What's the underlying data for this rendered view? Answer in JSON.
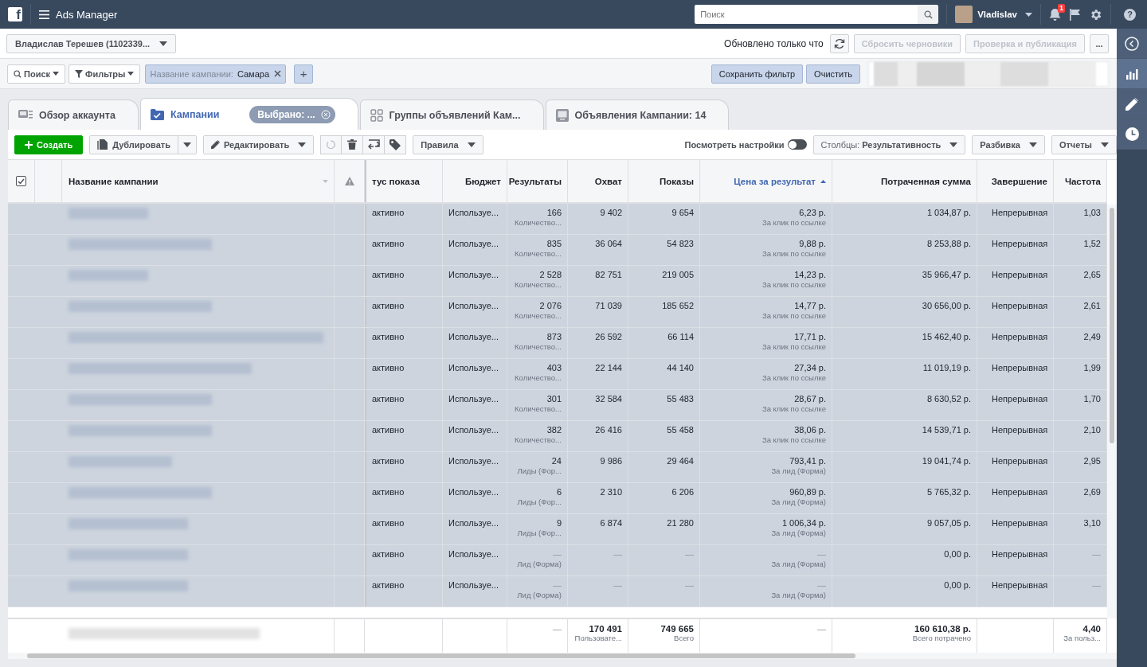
{
  "topbar": {
    "logo": "f",
    "app_title": "Ads Manager",
    "search_placeholder": "Поиск",
    "user": "Vladislav",
    "notification_count": "1",
    "help": "?"
  },
  "account_bar": {
    "account": "Владислав Терешев (1102339...",
    "updated": "Обновлено только что",
    "buttons": [
      {
        "label": "Сбросить черновики",
        "disabled": true
      },
      {
        "label": "Проверка и публикация",
        "disabled": true
      }
    ],
    "more": "..."
  },
  "filter_bar": {
    "search": "Поиск",
    "filters": "Фильтры",
    "chip": {
      "label": "Название кампании:",
      "value": "Самара"
    },
    "add": "+",
    "save_filter": "Сохранить фильтр",
    "clear": "Очистить"
  },
  "tabs": [
    {
      "kind": "overview",
      "label": "Обзор аккаунта",
      "selected": false
    },
    {
      "kind": "campaigns",
      "label": "Кампании",
      "selected": true,
      "badge": "Выбрано: ..."
    },
    {
      "kind": "adsets",
      "label": "Группы объявлений Кам...",
      "selected": false
    },
    {
      "kind": "ads",
      "label": "Объявления Кампании: 14",
      "selected": false
    }
  ],
  "toolbar": {
    "create": "Создать",
    "duplicate": "Дублировать",
    "edit": "Редактировать",
    "rules": "Правила",
    "view_settings": {
      "label": "Посмотреть настройки",
      "on": false
    },
    "columns": {
      "label": "Столбцы:",
      "value": "Результативность"
    },
    "breakdown": "Разбивка",
    "reports": "Отчеты"
  },
  "table": {
    "all_checked": true,
    "columns": [
      {
        "label": "Название кампании",
        "sorted": false
      },
      {
        "label": "тус показа",
        "sorted": false
      },
      {
        "label": "Бюджет",
        "sorted": false
      },
      {
        "label": "Результаты",
        "sorted": false
      },
      {
        "label": "Охват",
        "sorted": false
      },
      {
        "label": "Показы",
        "sorted": false
      },
      {
        "label": "Цена за результат",
        "sorted": true
      },
      {
        "label": "Потраченная сумма",
        "sorted": false
      },
      {
        "label": "Завершение",
        "sorted": false
      },
      {
        "label": "Частота",
        "sorted": false
      }
    ],
    "rows": [
      {
        "selected": true,
        "status": "активно",
        "budget": "Используе...",
        "results": "166",
        "results_sub": "Количество...",
        "reach": "9 402",
        "impressions": "9 654",
        "cost": "6,23 р.",
        "cost_sub": "За клик по ссылке",
        "spent": "1 034,87 р.",
        "end": "Непрерывная",
        "frequency": "1,03"
      },
      {
        "selected": true,
        "status": "активно",
        "budget": "Используе...",
        "results": "835",
        "results_sub": "Количество...",
        "reach": "36 064",
        "impressions": "54 823",
        "cost": "9,88 р.",
        "cost_sub": "За клик по ссылке",
        "spent": "8 253,88 р.",
        "end": "Непрерывная",
        "frequency": "1,52"
      },
      {
        "selected": true,
        "status": "активно",
        "budget": "Используе...",
        "results": "2 528",
        "results_sub": "Количество...",
        "reach": "82 751",
        "impressions": "219 005",
        "cost": "14,23 р.",
        "cost_sub": "За клик по ссылке",
        "spent": "35 966,47 р.",
        "end": "Непрерывная",
        "frequency": "2,65"
      },
      {
        "selected": true,
        "status": "активно",
        "budget": "Используе...",
        "results": "2 076",
        "results_sub": "Количество...",
        "reach": "71 039",
        "impressions": "185 652",
        "cost": "14,77 р.",
        "cost_sub": "За клик по ссылке",
        "spent": "30 656,00 р.",
        "end": "Непрерывная",
        "frequency": "2,61"
      },
      {
        "selected": true,
        "status": "активно",
        "budget": "Используе...",
        "results": "873",
        "results_sub": "Количество...",
        "reach": "26 592",
        "impressions": "66 114",
        "cost": "17,71 р.",
        "cost_sub": "За клик по ссылке",
        "spent": "15 462,40 р.",
        "end": "Непрерывная",
        "frequency": "2,49"
      },
      {
        "selected": true,
        "status": "активно",
        "budget": "Используе...",
        "results": "403",
        "results_sub": "Количество...",
        "reach": "22 144",
        "impressions": "44 140",
        "cost": "27,34 р.",
        "cost_sub": "За клик по ссылке",
        "spent": "11 019,19 р.",
        "end": "Непрерывная",
        "frequency": "1,99"
      },
      {
        "selected": true,
        "status": "активно",
        "budget": "Используе...",
        "results": "301",
        "results_sub": "Количество...",
        "reach": "32 584",
        "impressions": "55 483",
        "cost": "28,67 р.",
        "cost_sub": "За клик по ссылке",
        "spent": "8 630,52 р.",
        "end": "Непрерывная",
        "frequency": "1,70"
      },
      {
        "selected": true,
        "status": "активно",
        "budget": "Используе...",
        "results": "382",
        "results_sub": "Количество...",
        "reach": "26 416",
        "impressions": "55 458",
        "cost": "38,06 р.",
        "cost_sub": "За клик по ссылке",
        "spent": "14 539,71 р.",
        "end": "Непрерывная",
        "frequency": "2,10"
      },
      {
        "selected": true,
        "status": "активно",
        "budget": "Используе...",
        "results": "24",
        "results_sub": "Лиды (Фор...",
        "reach": "9 986",
        "impressions": "29 464",
        "cost": "793,41 р.",
        "cost_sub": "За лид (Форма)",
        "spent": "19 041,74 р.",
        "end": "Непрерывная",
        "frequency": "2,95"
      },
      {
        "selected": true,
        "status": "активно",
        "budget": "Используе...",
        "results": "6",
        "results_sub": "Лиды (Фор...",
        "reach": "2 310",
        "impressions": "6 206",
        "cost": "960,89 р.",
        "cost_sub": "За лид (Форма)",
        "spent": "5 765,32 р.",
        "end": "Непрерывная",
        "frequency": "2,69"
      },
      {
        "selected": true,
        "status": "активно",
        "budget": "Используе...",
        "results": "9",
        "results_sub": "Лиды (Фор...",
        "reach": "6 874",
        "impressions": "21 280",
        "cost": "1 006,34 р.",
        "cost_sub": "За лид (Форма)",
        "spent": "9 057,05 р.",
        "end": "Непрерывная",
        "frequency": "3,10"
      },
      {
        "selected": true,
        "status": "активно",
        "budget": "Используе...",
        "results": "—",
        "results_sub": "Лид (Форма)",
        "reach": "—",
        "impressions": "—",
        "cost": "—",
        "cost_sub": "За лид (Форма)",
        "spent": "0,00 р.",
        "end": "Непрерывная",
        "frequency": "—"
      },
      {
        "selected": true,
        "status": "активно",
        "budget": "Используе...",
        "results": "—",
        "results_sub": "Лид (Форма)",
        "reach": "—",
        "impressions": "—",
        "cost": "—",
        "cost_sub": "За лид (Форма)",
        "spent": "0,00 р.",
        "end": "Непрерывная",
        "frequency": "—"
      }
    ],
    "totals": {
      "results": "—",
      "reach": "170 491",
      "reach_sub": "Пользовате...",
      "impressions": "749 665",
      "impressions_sub": "Всего",
      "cost": "—",
      "spent": "160 610,38 р.",
      "spent_sub": "Всего потрачено",
      "frequency": "4,40",
      "frequency_sub": "За польз..."
    }
  }
}
